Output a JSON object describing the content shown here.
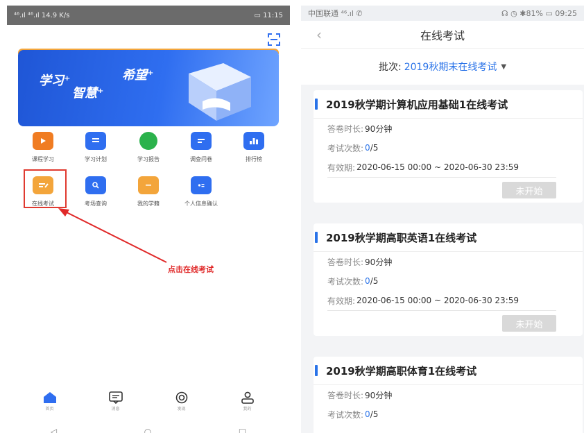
{
  "left": {
    "status": {
      "left": "⁴⁶.ıl ⁴⁶.ıl 14.9 K/s",
      "right": "▭ 11:15"
    },
    "banner": {
      "line1": "学习⁺",
      "line2": "智慧⁺",
      "line3": "希望⁺"
    },
    "grid_row1": [
      {
        "label": "课程学习",
        "icon": "play-icon",
        "color": "#f07c22"
      },
      {
        "label": "学习计划",
        "icon": "list-icon",
        "color": "#2f6ef0"
      },
      {
        "label": "学习报告",
        "icon": "pie-chart-icon",
        "color": "#2bb24c"
      },
      {
        "label": "调查问卷",
        "icon": "survey-icon",
        "color": "#2f6ef0"
      },
      {
        "label": "排行榜",
        "icon": "ranking-icon",
        "color": "#2f6ef0"
      }
    ],
    "grid_row2": [
      {
        "label": "在线考试",
        "icon": "exam-icon",
        "color": "#f3a53b"
      },
      {
        "label": "考场查询",
        "icon": "search-exam-icon",
        "color": "#2f6ef0"
      },
      {
        "label": "我的学籍",
        "icon": "folder-icon",
        "color": "#f3a53b"
      },
      {
        "label": "个人信息确认",
        "icon": "id-card-icon",
        "color": "#2f6ef0"
      }
    ],
    "annotation": "点击在线考试",
    "tabs": [
      {
        "label": "首页",
        "icon": "home-icon"
      },
      {
        "label": "消息",
        "icon": "message-icon"
      },
      {
        "label": "发现",
        "icon": "discover-icon"
      },
      {
        "label": "我的",
        "icon": "profile-icon"
      }
    ],
    "nav": [
      "◁",
      "○",
      "□"
    ]
  },
  "right": {
    "status": {
      "carrier": "中国联通 ⁴⁶.ıl ✆",
      "right": "☊ ◷ ✱81% ▭ 09:25"
    },
    "header": {
      "back": "‹",
      "title": "在线考试"
    },
    "batch": {
      "label": "批次:",
      "value": "2019秋期末在线考试"
    },
    "cards": [
      {
        "title": "2019秋学期计算机应用基础1在线考试",
        "duration_label": "答卷时长:",
        "duration": "90分钟",
        "attempts_label": "考试次数:",
        "attempts_used": "0",
        "attempts_total": "/5",
        "validity_label": "有效期:",
        "validity": "2020-06-15 00:00 ~ 2020-06-30 23:59",
        "button": "未开始"
      },
      {
        "title": "2019秋学期高职英语1在线考试",
        "duration_label": "答卷时长:",
        "duration": "90分钟",
        "attempts_label": "考试次数:",
        "attempts_used": "0",
        "attempts_total": "/5",
        "validity_label": "有效期:",
        "validity": "2020-06-15 00:00 ~ 2020-06-30 23:59",
        "button": "未开始"
      },
      {
        "title": "2019秋学期高职体育1在线考试",
        "duration_label": "答卷时长:",
        "duration": "90分钟",
        "attempts_label": "考试次数:",
        "attempts_used": "0",
        "attempts_total": "/5"
      }
    ]
  }
}
